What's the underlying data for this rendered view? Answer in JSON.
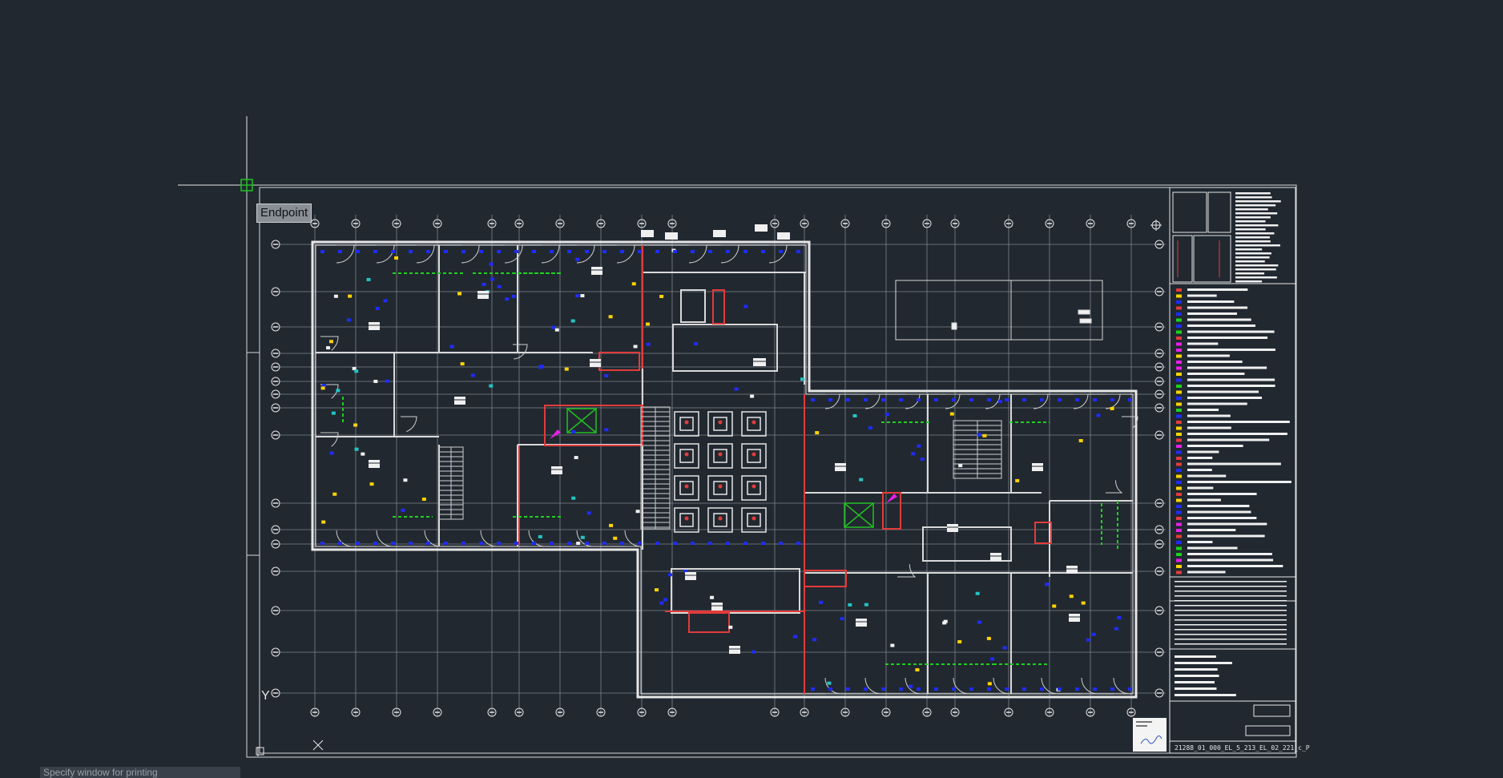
{
  "osnap_tooltip": "Endpoint",
  "command_prompt": "Specify window for printing",
  "sheet_number": "21288_01_000_EL_5_213_EL_02_221_c_P",
  "ucs": {
    "y_label": "Y",
    "x_label": "X"
  },
  "colors": {
    "background": "#212830",
    "walls": "#e6e6e6",
    "grid": "#9a9fa6",
    "fire_walls": "#e23b3b",
    "devices_blue": "#1f2cff",
    "cables_green": "#1dd11d",
    "accent_yellow": "#ffd400",
    "magenta": "#e81fe8",
    "snap_marker": "#22c022"
  },
  "icons": [
    "crosshair-cursor-icon",
    "osnap-endpoint-marker-icon",
    "ucs-icon",
    "north-arrow-icon",
    "signature-stamp-icon"
  ]
}
